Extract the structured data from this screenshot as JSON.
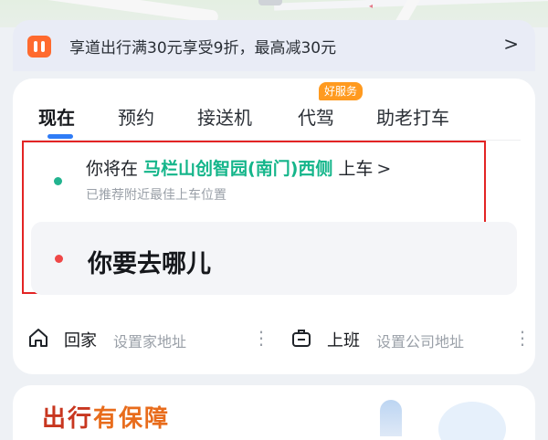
{
  "promo": {
    "text": "享道出行满30元享受9折，最高减30元",
    "chevron": ">"
  },
  "tabs": [
    {
      "label": "现在",
      "active": true
    },
    {
      "label": "预约",
      "active": false
    },
    {
      "label": "接送机",
      "active": false
    },
    {
      "label": "代驾",
      "active": false
    },
    {
      "label": "助老打车",
      "active": false
    }
  ],
  "tab_badge": "好服务",
  "pickup": {
    "prefix": "你将在",
    "location": "马栏山创智园(南门)西侧",
    "suffix": "上车",
    "chevron": ">",
    "hint": "已推荐附近最佳上车位置"
  },
  "destination": {
    "placeholder": "你要去哪儿"
  },
  "shortcuts": [
    {
      "name": "回家",
      "sub": "设置家地址",
      "icon": "home-icon"
    },
    {
      "name": "上班",
      "sub": "设置公司地址",
      "icon": "briefcase-icon"
    }
  ],
  "bottom_banner": {
    "title_part1": "出行",
    "title_part2": "有保障"
  },
  "colors": {
    "accent_blue": "#2f7cf6",
    "pickup_green": "#14b58a",
    "dest_red": "#ef4747",
    "badge_orange": "#ff9a1f",
    "highlight_red": "#e32424"
  }
}
